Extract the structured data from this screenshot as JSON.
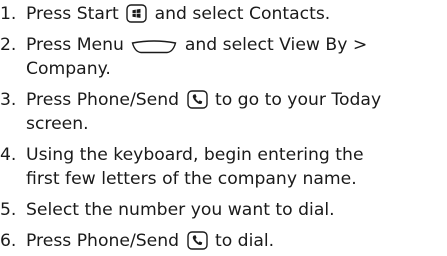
{
  "steps": [
    {
      "num": "1.",
      "before": "Press Start",
      "icon": "start-button-icon",
      "after": "and select Contacts."
    },
    {
      "num": "2.",
      "before": "Press Menu",
      "icon": "menu-softkey-icon",
      "after": "and select View By >",
      "line2": "Company."
    },
    {
      "num": "3.",
      "before": "Press Phone/Send",
      "icon": "phone-send-icon",
      "after": "to go to your Today",
      "line2": "screen."
    },
    {
      "num": "4.",
      "line1": "Using the keyboard, begin entering the",
      "line2": "first few letters of the company name."
    },
    {
      "num": "5.",
      "line1": "Select the number you want to dial."
    },
    {
      "num": "6.",
      "before": "Press Phone/Send",
      "icon": "phone-send-icon",
      "after": "to dial."
    }
  ]
}
